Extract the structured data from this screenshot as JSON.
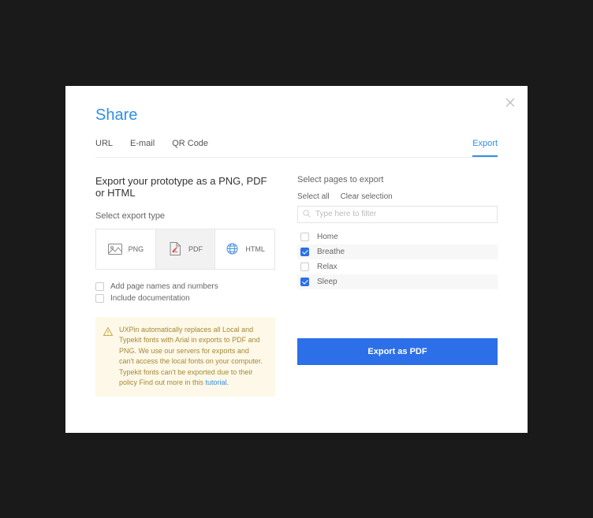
{
  "title": "Share",
  "tabs": {
    "url": "URL",
    "email": "E-mail",
    "qr": "QR Code",
    "export": "Export"
  },
  "heading": "Export your prototype as a PNG, PDF or HTML",
  "left": {
    "subheading": "Select export type",
    "types": {
      "png": "PNG",
      "pdf": "PDF",
      "html": "HTML"
    },
    "opt_names": "Add page names and numbers",
    "opt_docs": "Include documentation",
    "note": "UXPin automatically replaces all Local and Typekit fonts with Arial in exports to PDF and PNG. We use our servers for exports and can't access the local fonts on your computer. Typekit fonts can't be exported due to their policy Find out more in this ",
    "note_link": "tutorial."
  },
  "right": {
    "subheading": "Select pages to export",
    "select_all": "Select all",
    "clear": "Clear selection",
    "filter_placeholder": "Type here to filter",
    "pages": [
      {
        "name": "Home",
        "checked": false,
        "shaded": false
      },
      {
        "name": "Breathe",
        "checked": true,
        "shaded": true
      },
      {
        "name": "Relax",
        "checked": false,
        "shaded": false
      },
      {
        "name": "Sleep",
        "checked": true,
        "shaded": true
      }
    ],
    "button": "Export as PDF"
  }
}
